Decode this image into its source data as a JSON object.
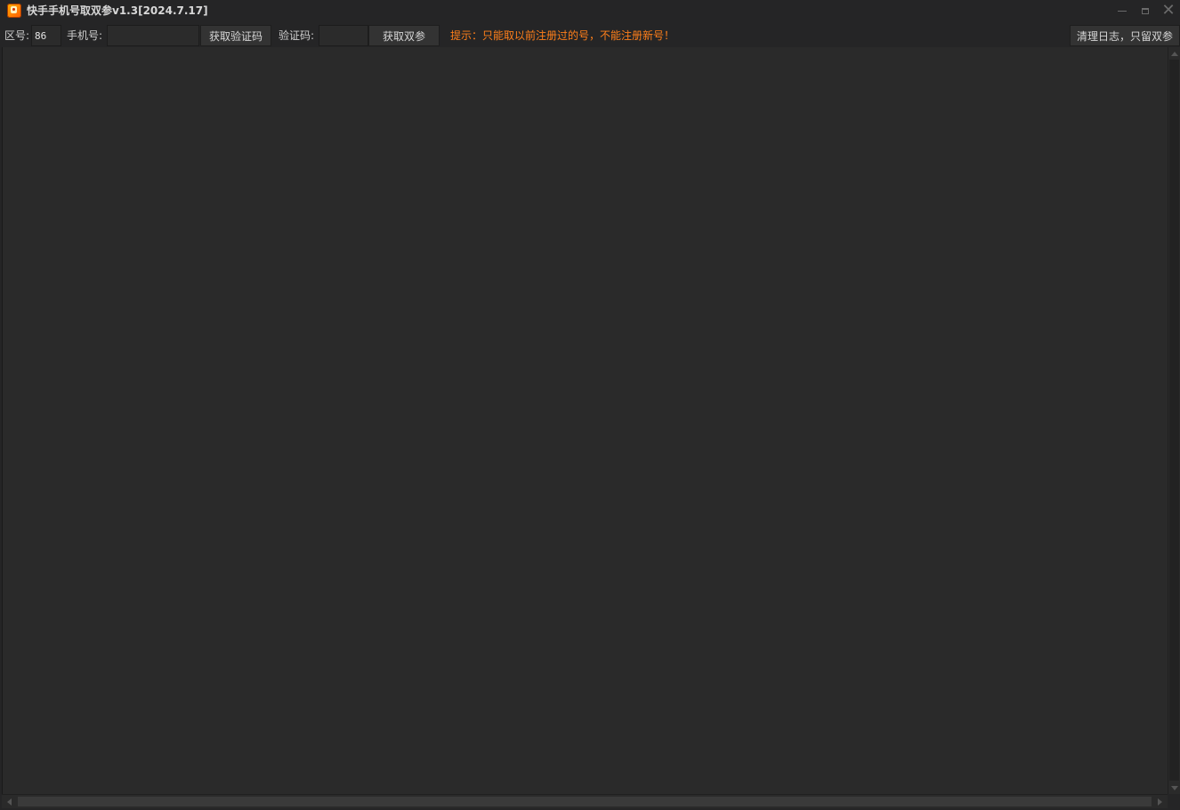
{
  "window": {
    "title": "快手手机号取双参v1.3[2024.7.17]",
    "icon": "kuaishou-app-icon",
    "controls": {
      "minimize_icon": "minimize-icon",
      "maximize_icon": "maximize-icon",
      "close_icon": "close-icon",
      "close_glyph": "✕"
    }
  },
  "toolbar": {
    "area_code_label": "区号:",
    "area_code_value": "86",
    "phone_label": "手机号:",
    "phone_value": "",
    "get_code_button": "获取验证码",
    "code_label": "验证码:",
    "code_value": "",
    "get_params_button": "获取双参",
    "tip": "提示：只能取以前注册过的号，不能注册新号！",
    "clear_log_button": "清理日志，只留双参"
  },
  "log": {
    "lines": []
  },
  "colors": {
    "background": "#252526",
    "log_background": "#2a2a2a",
    "tip_text": "#ff7f1a",
    "text": "#cfcfcf"
  }
}
